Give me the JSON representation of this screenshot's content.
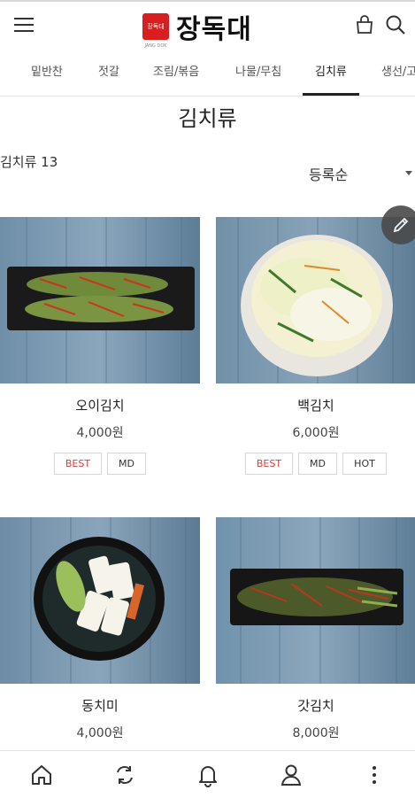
{
  "header": {
    "logo_badge_text": "장독대",
    "logo_sub_text": "JANG DOK",
    "logo_text": "장독대"
  },
  "tabs": [
    {
      "label": "밑반찬"
    },
    {
      "label": "젓갈"
    },
    {
      "label": "조림/볶음"
    },
    {
      "label": "나물/무침"
    },
    {
      "label": "김치류",
      "active": true
    },
    {
      "label": "생선/고"
    }
  ],
  "page": {
    "title": "김치류",
    "count_label": "김치류 13",
    "sort_label": "등록순"
  },
  "products": [
    {
      "name": "오이김치",
      "price": "4,000원",
      "badges": [
        "BEST",
        "MD"
      ]
    },
    {
      "name": "백김치",
      "price": "6,000원",
      "badges": [
        "BEST",
        "MD",
        "HOT"
      ]
    },
    {
      "name": "동치미",
      "price": "4,000원",
      "badges": []
    },
    {
      "name": "갓김치",
      "price": "8,000원",
      "badges": []
    }
  ],
  "icons": {
    "menu": "menu-icon",
    "bag": "shopping-bag-icon",
    "search": "search-icon",
    "edit": "pencil-icon",
    "nav": [
      "home-icon",
      "refresh-icon",
      "bell-icon",
      "user-icon",
      "more-vertical-icon"
    ]
  },
  "colors": {
    "brand": "#d81e1e",
    "best_badge": "#e23b3b"
  }
}
